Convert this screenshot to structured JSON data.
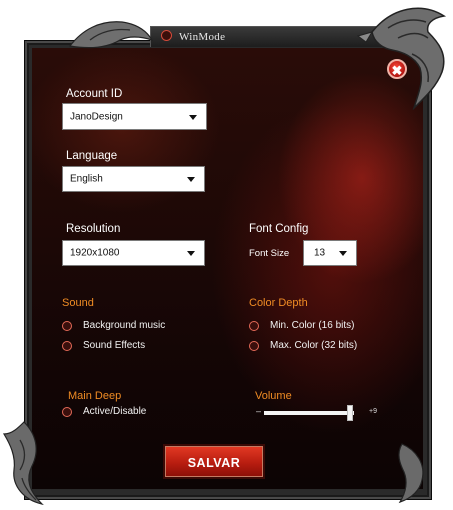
{
  "window": {
    "title": "WinMode"
  },
  "account": {
    "label": "Account ID",
    "value": "JanoDesign"
  },
  "language": {
    "label": "Language",
    "value": "English"
  },
  "resolution": {
    "label": "Resolution",
    "value": "1920x1080"
  },
  "font_config": {
    "label": "Font Config",
    "size_label": "Font Size",
    "size_value": "13"
  },
  "sound": {
    "label": "Sound",
    "options": [
      {
        "label": "Background music"
      },
      {
        "label": "Sound Effects"
      }
    ]
  },
  "color_depth": {
    "label": "Color Depth",
    "options": [
      {
        "label": "Min. Color (16 bits)"
      },
      {
        "label": "Max. Color (32 bits)"
      }
    ]
  },
  "main_deep": {
    "label": "Main Deep",
    "option": "Active/Disable"
  },
  "volume": {
    "label": "Volume",
    "min_label": "–",
    "max_label": "+9",
    "level": 0.95
  },
  "actions": {
    "save_label": "SALVAR",
    "close_glyph": "✖"
  },
  "icons": {
    "close": "close-icon",
    "dropdown": "chevron-down-icon",
    "dragon_top": "dragon-ornament-icon",
    "dragon_bottom": "dragon-ornament-icon"
  },
  "colors": {
    "accent_orange": "#f08c24",
    "button_red": "#c4200f",
    "radio_ring": "#e46a58"
  }
}
